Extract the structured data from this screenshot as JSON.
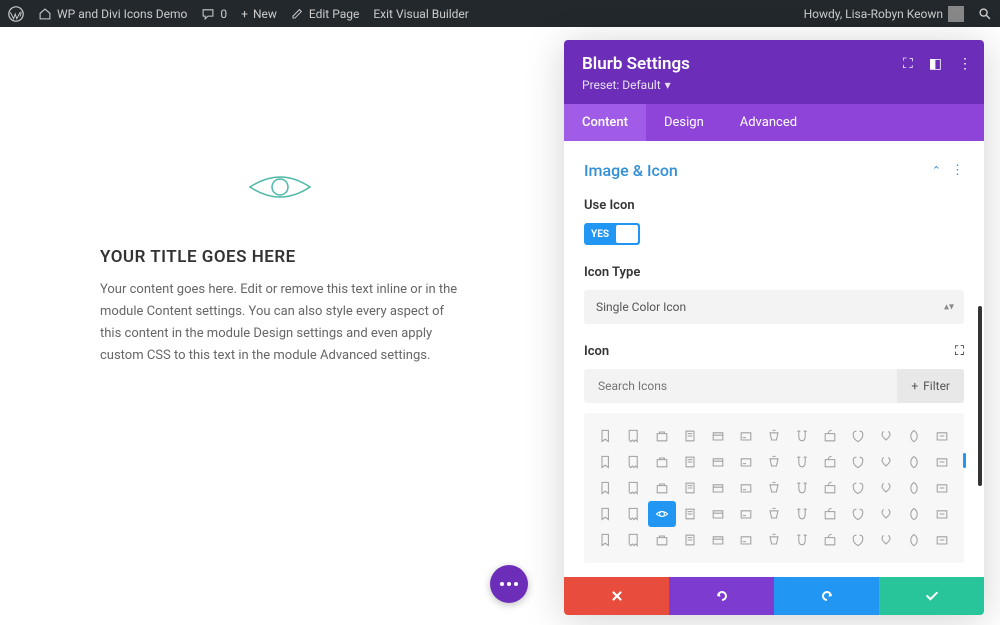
{
  "admin": {
    "site_name": "WP and Divi Icons Demo",
    "comments": "0",
    "new": "New",
    "edit": "Edit Page",
    "exit": "Exit Visual Builder",
    "greeting": "Howdy, Lisa-Robyn Keown"
  },
  "page": {
    "title": "YOUR TITLE GOES HERE",
    "content": "Your content goes here. Edit or remove this text inline or in the module Content settings. You can also style every aspect of this content in the module Design settings and even apply custom CSS to this text in the module Advanced settings."
  },
  "panel": {
    "title": "Blurb Settings",
    "preset": "Preset: Default",
    "tabs": {
      "content": "Content",
      "design": "Design",
      "advanced": "Advanced"
    },
    "section": "Image & Icon",
    "use_icon_label": "Use Icon",
    "toggle_value": "YES",
    "icon_type_label": "Icon Type",
    "icon_type_value": "Single Color Icon",
    "icon_label": "Icon",
    "search_placeholder": "Search Icons",
    "filter": "Filter"
  }
}
